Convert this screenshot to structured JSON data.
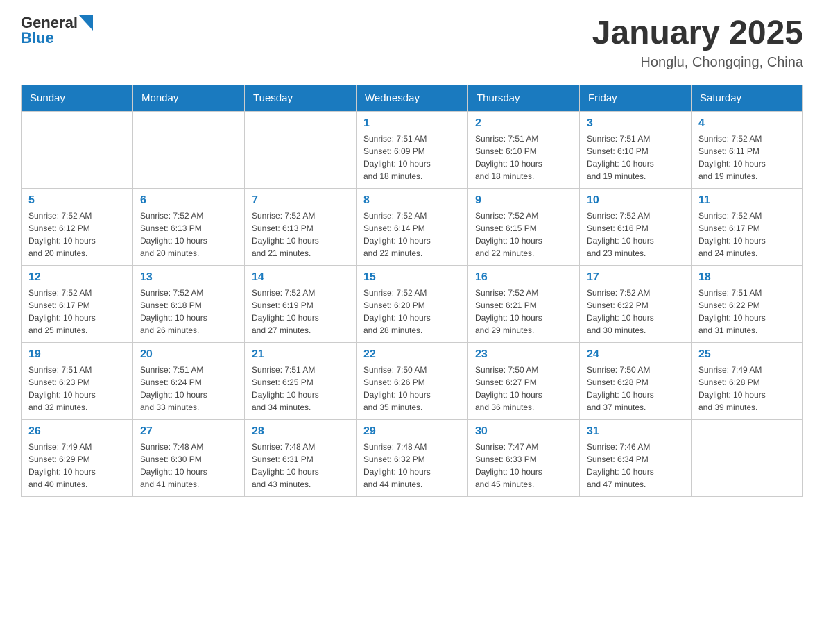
{
  "header": {
    "logo_general": "General",
    "logo_blue": "Blue",
    "month_title": "January 2025",
    "location": "Honglu, Chongqing, China"
  },
  "weekdays": [
    "Sunday",
    "Monday",
    "Tuesday",
    "Wednesday",
    "Thursday",
    "Friday",
    "Saturday"
  ],
  "weeks": [
    [
      {
        "day": "",
        "info": ""
      },
      {
        "day": "",
        "info": ""
      },
      {
        "day": "",
        "info": ""
      },
      {
        "day": "1",
        "info": "Sunrise: 7:51 AM\nSunset: 6:09 PM\nDaylight: 10 hours\nand 18 minutes."
      },
      {
        "day": "2",
        "info": "Sunrise: 7:51 AM\nSunset: 6:10 PM\nDaylight: 10 hours\nand 18 minutes."
      },
      {
        "day": "3",
        "info": "Sunrise: 7:51 AM\nSunset: 6:10 PM\nDaylight: 10 hours\nand 19 minutes."
      },
      {
        "day": "4",
        "info": "Sunrise: 7:52 AM\nSunset: 6:11 PM\nDaylight: 10 hours\nand 19 minutes."
      }
    ],
    [
      {
        "day": "5",
        "info": "Sunrise: 7:52 AM\nSunset: 6:12 PM\nDaylight: 10 hours\nand 20 minutes."
      },
      {
        "day": "6",
        "info": "Sunrise: 7:52 AM\nSunset: 6:13 PM\nDaylight: 10 hours\nand 20 minutes."
      },
      {
        "day": "7",
        "info": "Sunrise: 7:52 AM\nSunset: 6:13 PM\nDaylight: 10 hours\nand 21 minutes."
      },
      {
        "day": "8",
        "info": "Sunrise: 7:52 AM\nSunset: 6:14 PM\nDaylight: 10 hours\nand 22 minutes."
      },
      {
        "day": "9",
        "info": "Sunrise: 7:52 AM\nSunset: 6:15 PM\nDaylight: 10 hours\nand 22 minutes."
      },
      {
        "day": "10",
        "info": "Sunrise: 7:52 AM\nSunset: 6:16 PM\nDaylight: 10 hours\nand 23 minutes."
      },
      {
        "day": "11",
        "info": "Sunrise: 7:52 AM\nSunset: 6:17 PM\nDaylight: 10 hours\nand 24 minutes."
      }
    ],
    [
      {
        "day": "12",
        "info": "Sunrise: 7:52 AM\nSunset: 6:17 PM\nDaylight: 10 hours\nand 25 minutes."
      },
      {
        "day": "13",
        "info": "Sunrise: 7:52 AM\nSunset: 6:18 PM\nDaylight: 10 hours\nand 26 minutes."
      },
      {
        "day": "14",
        "info": "Sunrise: 7:52 AM\nSunset: 6:19 PM\nDaylight: 10 hours\nand 27 minutes."
      },
      {
        "day": "15",
        "info": "Sunrise: 7:52 AM\nSunset: 6:20 PM\nDaylight: 10 hours\nand 28 minutes."
      },
      {
        "day": "16",
        "info": "Sunrise: 7:52 AM\nSunset: 6:21 PM\nDaylight: 10 hours\nand 29 minutes."
      },
      {
        "day": "17",
        "info": "Sunrise: 7:52 AM\nSunset: 6:22 PM\nDaylight: 10 hours\nand 30 minutes."
      },
      {
        "day": "18",
        "info": "Sunrise: 7:51 AM\nSunset: 6:22 PM\nDaylight: 10 hours\nand 31 minutes."
      }
    ],
    [
      {
        "day": "19",
        "info": "Sunrise: 7:51 AM\nSunset: 6:23 PM\nDaylight: 10 hours\nand 32 minutes."
      },
      {
        "day": "20",
        "info": "Sunrise: 7:51 AM\nSunset: 6:24 PM\nDaylight: 10 hours\nand 33 minutes."
      },
      {
        "day": "21",
        "info": "Sunrise: 7:51 AM\nSunset: 6:25 PM\nDaylight: 10 hours\nand 34 minutes."
      },
      {
        "day": "22",
        "info": "Sunrise: 7:50 AM\nSunset: 6:26 PM\nDaylight: 10 hours\nand 35 minutes."
      },
      {
        "day": "23",
        "info": "Sunrise: 7:50 AM\nSunset: 6:27 PM\nDaylight: 10 hours\nand 36 minutes."
      },
      {
        "day": "24",
        "info": "Sunrise: 7:50 AM\nSunset: 6:28 PM\nDaylight: 10 hours\nand 37 minutes."
      },
      {
        "day": "25",
        "info": "Sunrise: 7:49 AM\nSunset: 6:28 PM\nDaylight: 10 hours\nand 39 minutes."
      }
    ],
    [
      {
        "day": "26",
        "info": "Sunrise: 7:49 AM\nSunset: 6:29 PM\nDaylight: 10 hours\nand 40 minutes."
      },
      {
        "day": "27",
        "info": "Sunrise: 7:48 AM\nSunset: 6:30 PM\nDaylight: 10 hours\nand 41 minutes."
      },
      {
        "day": "28",
        "info": "Sunrise: 7:48 AM\nSunset: 6:31 PM\nDaylight: 10 hours\nand 43 minutes."
      },
      {
        "day": "29",
        "info": "Sunrise: 7:48 AM\nSunset: 6:32 PM\nDaylight: 10 hours\nand 44 minutes."
      },
      {
        "day": "30",
        "info": "Sunrise: 7:47 AM\nSunset: 6:33 PM\nDaylight: 10 hours\nand 45 minutes."
      },
      {
        "day": "31",
        "info": "Sunrise: 7:46 AM\nSunset: 6:34 PM\nDaylight: 10 hours\nand 47 minutes."
      },
      {
        "day": "",
        "info": ""
      }
    ]
  ]
}
